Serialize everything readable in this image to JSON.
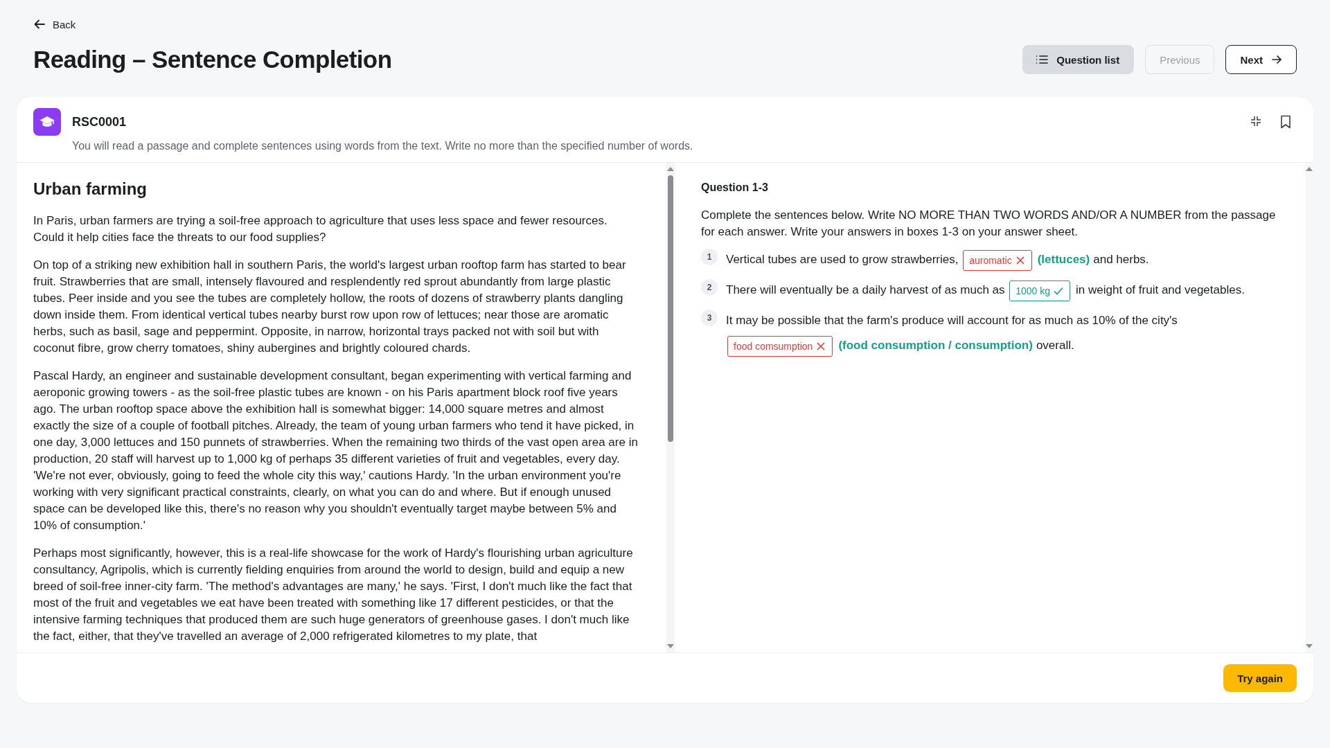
{
  "back_link": "Back",
  "title": "Reading – Sentence Completion",
  "nav_buttons": [
    {
      "kind": "list",
      "label": "Question list",
      "disabled": false
    },
    {
      "kind": "prev",
      "label": "Previous",
      "disabled": true
    },
    {
      "kind": "next",
      "label": "Next",
      "disabled": false
    }
  ],
  "card": {
    "code": "RSC0001",
    "description": "You will read a passage and complete sentences using words from the text. Write no more than the specified number of words."
  },
  "passage": {
    "title": "Urban farming",
    "paragraphs": [
      "In Paris, urban farmers are trying a soil-free approach to agriculture that uses less space and fewer resources. Could it help cities face the threats to our food supplies?",
      "On top of a striking new exhibition hall in southern Paris, the world's largest urban rooftop farm has started to bear fruit. Strawberries that are small, intensely flavoured and resplendently red sprout abundantly from large plastic tubes. Peer inside and you see the tubes are completely hollow, the roots of dozens of strawberry plants dangling down inside them. From identical vertical tubes nearby burst row upon row of lettuces; near those are aromatic herbs, such as basil, sage and peppermint. Opposite, in narrow, horizontal trays packed not with soil but with coconut fibre, grow cherry tomatoes, shiny aubergines and brightly coloured chards.",
      "Pascal Hardy, an engineer and sustainable development consultant, began experimenting with vertical farming and aeroponic growing towers - as the soil-free plastic tubes are known - on his Paris apartment block roof five years ago. The urban rooftop space above the exhibition hall is somewhat bigger: 14,000 square metres and almost exactly the size of a couple of football pitches. Already, the team of young urban farmers who tend it have picked, in one day, 3,000 lettuces and 150 punnets of strawberries. When the remaining two thirds of the vast open area are in production, 20 staff will harvest up to 1,000 kg of perhaps 35 different varieties of fruit and vegetables, every day. 'We're not ever, obviously, going to feed the whole city this way,' cautions Hardy. 'In the urban environment you're working with very significant practical constraints, clearly, on what you can do and where. But if enough unused space can be developed like this, there's no reason why you shouldn't eventually target maybe between 5% and 10% of consumption.'",
      "Perhaps most significantly, however, this is a real-life showcase for the work of Hardy's flourishing urban agriculture consultancy, Agripolis, which is currently fielding enquiries from around the world to design, build and equip a new breed of soil-free inner-city farm. 'The method's advantages are many,' he says. 'First, I don't much like the fact that most of the fruit and vegetables we eat have been treated with something like 17 different pesticides, or that the intensive farming techniques that produced them are such huge generators of greenhouse gases. I don't much like the fact, either, that they've travelled an average of 2,000 refrigerated kilometres to my plate, that"
    ]
  },
  "questions": {
    "heading": "Question 1-3",
    "instructions": "Complete the sentences below. Write NO MORE THAN TWO WORDS AND/OR A NUMBER from the passage for each answer. Write your answers in boxes 1-3 on your answer sheet.",
    "items": [
      {
        "number": "1",
        "before": "Vertical tubes are used to grow strawberries,",
        "answer": "auromatic",
        "correct": false,
        "solution": "(lettuces)",
        "after": "and herbs."
      },
      {
        "number": "2",
        "before": "There will eventually be a daily harvest of as much as",
        "answer": "1000 kg",
        "correct": true,
        "after": "in weight of fruit and vegetables."
      },
      {
        "number": "3",
        "before": "It may be possible that the farm's produce will account for as much as 10% of the city's",
        "answer": "food comsumption",
        "correct": false,
        "solution": "(food consumption / consumption)",
        "after": "overall."
      }
    ]
  },
  "try_again": "Try again"
}
